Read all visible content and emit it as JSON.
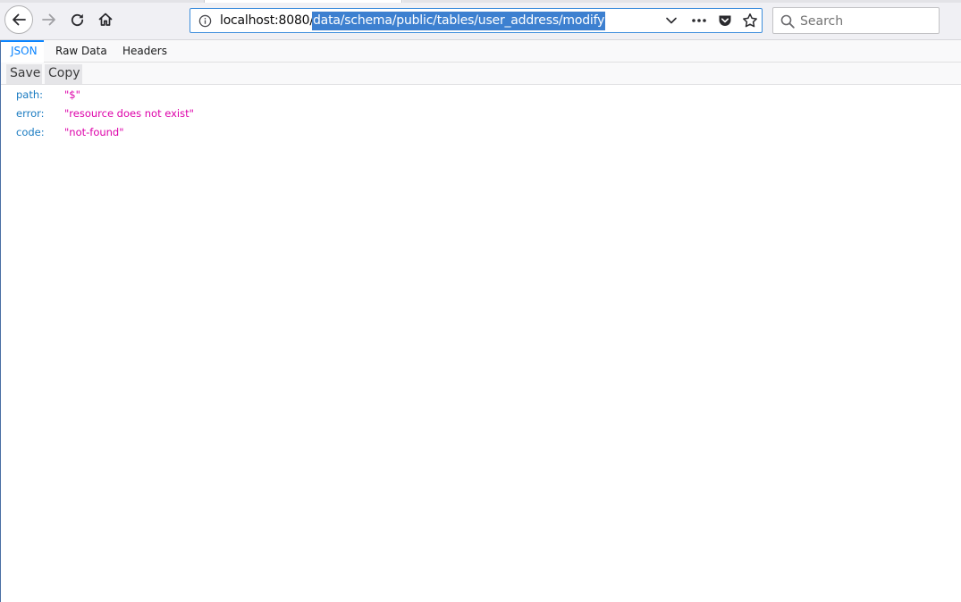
{
  "browser": {
    "url_host": "localhost:8080/",
    "url_path": "data/schema/public/tables/user_address/modify",
    "search_placeholder": "Search"
  },
  "viewer": {
    "tabs": [
      {
        "label": "JSON",
        "active": true
      },
      {
        "label": "Raw Data",
        "active": false
      },
      {
        "label": "Headers",
        "active": false
      }
    ],
    "actions": {
      "save_label": "Save",
      "copy_label": "Copy"
    },
    "rows": [
      {
        "key": "path:",
        "value": "\"$\""
      },
      {
        "key": "error:",
        "value": "\"resource does not exist\""
      },
      {
        "key": "code:",
        "value": "\"not-found\""
      }
    ]
  },
  "colors": {
    "accent": "#0a84ff",
    "json_key": "#1a7bc1",
    "json_string": "#dd00a9",
    "url_selection": "#3d80d0"
  },
  "icons": [
    "back-arrow-icon",
    "forward-arrow-icon",
    "reload-icon",
    "home-icon",
    "info-icon",
    "dropdown-chevron-icon",
    "more-dots-icon",
    "pocket-icon",
    "bookmark-star-icon",
    "search-icon"
  ]
}
